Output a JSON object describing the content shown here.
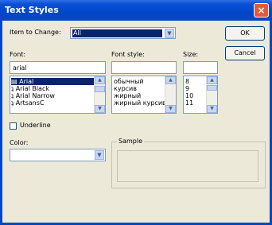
{
  "window": {
    "title": "Text Styles",
    "close_glyph": "×"
  },
  "item_to_change": {
    "label": "Item to Change:",
    "value": "All"
  },
  "buttons": {
    "ok": "OK",
    "cancel": "Cancel"
  },
  "font": {
    "label": "Font:",
    "value": "arial",
    "items": [
      "Arial",
      "Arial Black",
      "Arial Narrow",
      "ArtsansC"
    ],
    "selected": 0
  },
  "font_style": {
    "label": "Font style:",
    "value": "",
    "items": [
      "обычный",
      "курсив",
      "жирный",
      "жирный курсив"
    ]
  },
  "size": {
    "label": "Size:",
    "value": "",
    "items": [
      "8",
      "9",
      "10",
      "11"
    ]
  },
  "underline": {
    "label": "Underline",
    "checked": false
  },
  "color": {
    "label": "Color:",
    "value": ""
  },
  "sample": {
    "label": "Sample"
  },
  "colors": {
    "title_bar": "#0046c8",
    "selection": "#0a246a",
    "dialog_bg": "#ece9d8",
    "close": "#e05b3b"
  }
}
